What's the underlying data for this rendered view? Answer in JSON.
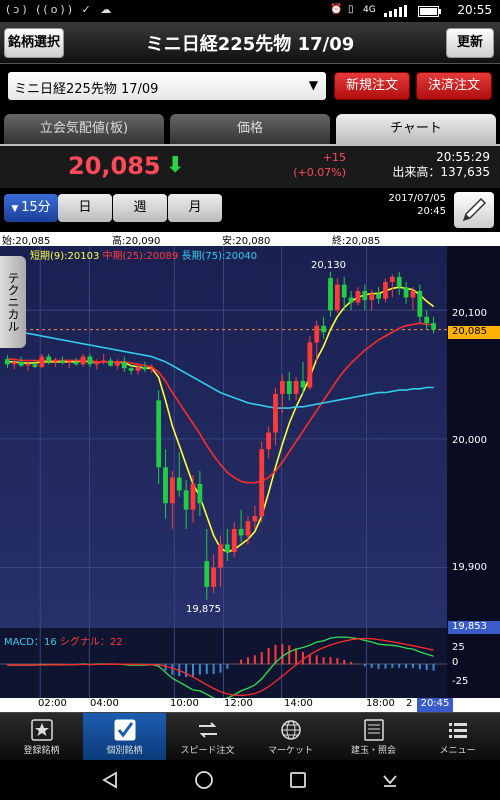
{
  "statusbar": {
    "time": "20:55",
    "icons_left": "(ↄ) ((o)) ✓ ☁",
    "network": "4G"
  },
  "header": {
    "left_button": "銘柄選択",
    "title": "ミニ日経225先物 17/09",
    "right_button": "更新"
  },
  "order": {
    "symbol_select": "ミニ日経225先物 17/09",
    "new_order": "新規注文",
    "settle_order": "決済注文"
  },
  "tabs": [
    {
      "label": "立会気配値(板)",
      "active": false
    },
    {
      "label": "価格",
      "active": false
    },
    {
      "label": "チャート",
      "active": true
    }
  ],
  "quote": {
    "price": "20,085",
    "change": "+15",
    "change_pct": "(+0.07%)",
    "time": "20:55:29",
    "volume_label": "出来高：",
    "volume": "137,635"
  },
  "periods": [
    {
      "label": "15分",
      "active": true
    },
    {
      "label": "日",
      "active": false
    },
    {
      "label": "週",
      "active": false
    },
    {
      "label": "月",
      "active": false
    }
  ],
  "chart_date": "2017/07/05",
  "chart_time": "20:45",
  "ohlc": {
    "open": "始:20,085",
    "high": "高:20,090",
    "low": "安:20,080",
    "close": "終:20,085"
  },
  "technical_tab": "テクニカル",
  "ma_legend": {
    "short": "短期(9):20103",
    "mid": "中期(25):20089",
    "long": "長期(75):20040"
  },
  "macd_legend": {
    "macd": "MACD：16",
    "signal": "シグナル：22"
  },
  "nav": [
    {
      "label": "登録銘柄",
      "icon": "star-icon",
      "active": false
    },
    {
      "label": "個別銘柄",
      "icon": "check-icon",
      "active": true
    },
    {
      "label": "スピード注文",
      "icon": "arrows-icon",
      "active": false
    },
    {
      "label": "マーケット",
      "icon": "globe-icon",
      "active": false
    },
    {
      "label": "建玉・照会",
      "icon": "list-icon",
      "active": false
    },
    {
      "label": "メニュー",
      "icon": "menu-icon",
      "active": false
    }
  ],
  "colors": {
    "up": "#ff3a3a",
    "down": "#22cc44",
    "short_ma": "#ffff33",
    "mid_ma": "#ff2a2a",
    "long_ma": "#33ccee",
    "bg": "#1c2450"
  },
  "chart_data": {
    "type": "candlestick",
    "ylim": [
      19853,
      20150
    ],
    "y_ticks": [
      "20,100",
      "20,000",
      "19,900"
    ],
    "y_tick_values": [
      20100,
      20000,
      19900
    ],
    "current_price_label": "20,085",
    "current_price": 20085,
    "low_axis_label": "19,853",
    "high_annotation": "20,130",
    "low_annotation": "19,875",
    "x_ticks": [
      "02:00",
      "04:00",
      "10:00",
      "12:00",
      "14:00",
      "18:00",
      "2"
    ],
    "last_time_label": "20:45",
    "macd_ticks": [
      "25",
      "0",
      "-25"
    ],
    "candles": [
      [
        20062,
        20065,
        20055,
        20058
      ],
      [
        20058,
        20062,
        20054,
        20060
      ],
      [
        20060,
        20064,
        20056,
        20057
      ],
      [
        20057,
        20060,
        20053,
        20058
      ],
      [
        20058,
        20061,
        20055,
        20056
      ],
      [
        20056,
        20066,
        20055,
        20064
      ],
      [
        20064,
        20066,
        20058,
        20060
      ],
      [
        20060,
        20063,
        20056,
        20061
      ],
      [
        20061,
        20064,
        20058,
        20059
      ],
      [
        20059,
        20062,
        20055,
        20060
      ],
      [
        20060,
        20063,
        20057,
        20058
      ],
      [
        20058,
        20066,
        20056,
        20064
      ],
      [
        20064,
        20066,
        20056,
        20058
      ],
      [
        20058,
        20062,
        20054,
        20060
      ],
      [
        20060,
        20066,
        20058,
        20061
      ],
      [
        20061,
        20063,
        20056,
        20057
      ],
      [
        20057,
        20062,
        20054,
        20060
      ],
      [
        20060,
        20064,
        20052,
        20055
      ],
      [
        20055,
        20058,
        20050,
        20053
      ],
      [
        20053,
        20058,
        20050,
        20056
      ],
      [
        20056,
        20060,
        20052,
        20054
      ],
      [
        20054,
        20058,
        20051,
        20055
      ],
      [
        20030,
        20038,
        19965,
        19978
      ],
      [
        19978,
        19992,
        19938,
        19950
      ],
      [
        19950,
        19975,
        19930,
        19970
      ],
      [
        19970,
        19990,
        19955,
        19960
      ],
      [
        19960,
        19968,
        19930,
        19945
      ],
      [
        19945,
        19972,
        19935,
        19965
      ],
      [
        19965,
        19975,
        19940,
        19950
      ],
      [
        19905,
        19930,
        19875,
        19885
      ],
      [
        19885,
        19910,
        19880,
        19900
      ],
      [
        19900,
        19925,
        19885,
        19918
      ],
      [
        19918,
        19930,
        19905,
        19912
      ],
      [
        19912,
        19935,
        19908,
        19930
      ],
      [
        19930,
        19945,
        19920,
        19925
      ],
      [
        19925,
        19940,
        19918,
        19936
      ],
      [
        19936,
        19948,
        19930,
        19940
      ],
      [
        19940,
        19998,
        19935,
        19992
      ],
      [
        19992,
        20010,
        19985,
        20005
      ],
      [
        20005,
        20040,
        19995,
        20035
      ],
      [
        20035,
        20050,
        20020,
        20045
      ],
      [
        20045,
        20052,
        20030,
        20035
      ],
      [
        20035,
        20048,
        20030,
        20045
      ],
      [
        20045,
        20060,
        20035,
        20040
      ],
      [
        20040,
        20080,
        20038,
        20075
      ],
      [
        20075,
        20092,
        20060,
        20088
      ],
      [
        20088,
        20095,
        20078,
        20083
      ],
      [
        20125,
        20130,
        20095,
        20100
      ],
      [
        20100,
        20125,
        20098,
        20120
      ],
      [
        20120,
        20126,
        20100,
        20110
      ],
      [
        20110,
        20115,
        20100,
        20106
      ],
      [
        20106,
        20118,
        20104,
        20115
      ],
      [
        20115,
        20120,
        20100,
        20108
      ],
      [
        20108,
        20116,
        20100,
        20113
      ],
      [
        20113,
        20118,
        20105,
        20109
      ],
      [
        20109,
        20125,
        20106,
        20122
      ],
      [
        20122,
        20128,
        20110,
        20126
      ],
      [
        20126,
        20130,
        20112,
        20118
      ],
      [
        20118,
        20122,
        20105,
        20110
      ],
      [
        20110,
        20118,
        20100,
        20115
      ],
      [
        20115,
        20120,
        20090,
        20095
      ],
      [
        20095,
        20100,
        20085,
        20090
      ],
      [
        20090,
        20095,
        20082,
        20085
      ]
    ],
    "series": [
      {
        "name": "短期(9)",
        "values": [
          20060,
          20060,
          20059,
          20059,
          20059,
          20060,
          20060,
          20060,
          20060,
          20060,
          20060,
          20061,
          20060,
          20060,
          20060,
          20060,
          20060,
          20059,
          20057,
          20056,
          20055,
          20055,
          20048,
          20030,
          20010,
          19995,
          19980,
          19965,
          19955,
          19940,
          19925,
          19915,
          19912,
          19914,
          19918,
          19922,
          19928,
          19940,
          19958,
          19978,
          19996,
          20012,
          20025,
          20036,
          20048,
          20062,
          20072,
          20085,
          20095,
          20102,
          20107,
          20110,
          20112,
          20113,
          20113,
          20115,
          20117,
          20118,
          20117,
          20116,
          20112,
          20107,
          20103
        ]
      },
      {
        "name": "中期(25)",
        "values": [
          20062,
          20062,
          20061,
          20061,
          20061,
          20061,
          20061,
          20061,
          20061,
          20061,
          20061,
          20061,
          20061,
          20060,
          20060,
          20060,
          20060,
          20060,
          20059,
          20058,
          20057,
          20056,
          20052,
          20045,
          20036,
          20028,
          20020,
          20012,
          20004,
          19995,
          19987,
          19980,
          19974,
          19970,
          19967,
          19966,
          19966,
          19967,
          19970,
          19975,
          19982,
          19990,
          19998,
          20006,
          20014,
          20022,
          20030,
          20038,
          20046,
          20053,
          20059,
          20064,
          20069,
          20073,
          20077,
          20080,
          20083,
          20086,
          20088,
          20089,
          20090,
          20089,
          20089
        ]
      },
      {
        "name": "長期(75)",
        "values": [
          20085,
          20084,
          20083,
          20082,
          20081,
          20080,
          20079,
          20078,
          20077,
          20076,
          20075,
          20074,
          20073,
          20072,
          20071,
          20070,
          20069,
          20068,
          20067,
          20066,
          20065,
          20064,
          20062,
          20060,
          20057,
          20054,
          20051,
          20048,
          20045,
          20042,
          20039,
          20036,
          20034,
          20032,
          20030,
          20028,
          20027,
          20026,
          20025,
          20024,
          20024,
          20024,
          20025,
          20025,
          20026,
          20027,
          20028,
          20029,
          20030,
          20031,
          20032,
          20033,
          20034,
          20035,
          20036,
          20036,
          20037,
          20038,
          20038,
          20039,
          20039,
          20040,
          20040
        ]
      }
    ]
  }
}
